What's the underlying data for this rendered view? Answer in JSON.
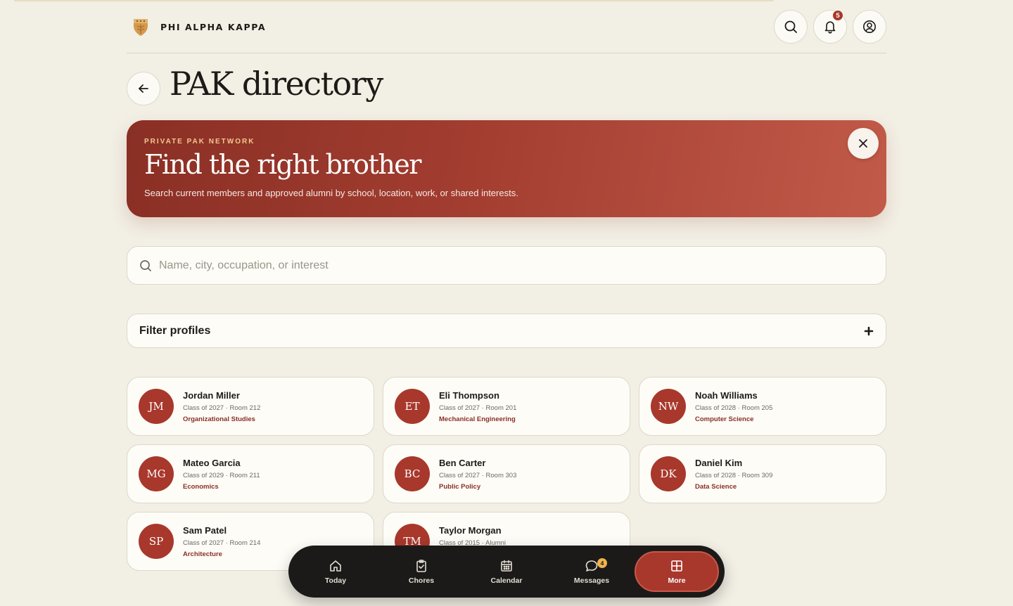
{
  "brand": {
    "name": "PHI ALPHA KAPPA"
  },
  "header": {
    "notifications_count": "5",
    "icons": [
      "search-icon",
      "bell-icon",
      "user-icon"
    ]
  },
  "page": {
    "title": "PAK directory"
  },
  "hero": {
    "eyebrow": "PRIVATE PAK NETWORK",
    "title": "Find the right brother",
    "subtitle": "Search current members and approved alumni by school, location, work, or shared interests."
  },
  "search": {
    "placeholder": "Name, city, occupation, or interest",
    "value": ""
  },
  "filter": {
    "label": "Filter profiles"
  },
  "members": [
    {
      "initials": "JM",
      "name": "Jordan Miller",
      "meta": "Class of 2027 · Room 212",
      "major": "Organizational Studies"
    },
    {
      "initials": "ET",
      "name": "Eli Thompson",
      "meta": "Class of 2027 · Room 201",
      "major": "Mechanical Engineering"
    },
    {
      "initials": "NW",
      "name": "Noah Williams",
      "meta": "Class of 2028 · Room 205",
      "major": "Computer Science"
    },
    {
      "initials": "MG",
      "name": "Mateo Garcia",
      "meta": "Class of 2029 · Room 211",
      "major": "Economics"
    },
    {
      "initials": "BC",
      "name": "Ben Carter",
      "meta": "Class of 2027 · Room 303",
      "major": "Public Policy"
    },
    {
      "initials": "DK",
      "name": "Daniel Kim",
      "meta": "Class of 2028 · Room 309",
      "major": "Data Science"
    },
    {
      "initials": "SP",
      "name": "Sam Patel",
      "meta": "Class of 2027 · Room 214",
      "major": "Architecture"
    },
    {
      "initials": "TM",
      "name": "Taylor Morgan",
      "meta": "Class of 2015 · Alumni",
      "major": ""
    }
  ],
  "nav": {
    "items": [
      {
        "label": "Today",
        "icon": "home-icon"
      },
      {
        "label": "Chores",
        "icon": "clipboard-icon"
      },
      {
        "label": "Calendar",
        "icon": "calendar-icon"
      },
      {
        "label": "Messages",
        "icon": "chat-icon",
        "badge": "4"
      },
      {
        "label": "More",
        "icon": "grid-icon",
        "active": true
      }
    ]
  },
  "colors": {
    "accent": "#a8382c",
    "background": "#f2efe5",
    "badge_gold": "#f0b34e",
    "nav_bg": "#1c1a18"
  }
}
